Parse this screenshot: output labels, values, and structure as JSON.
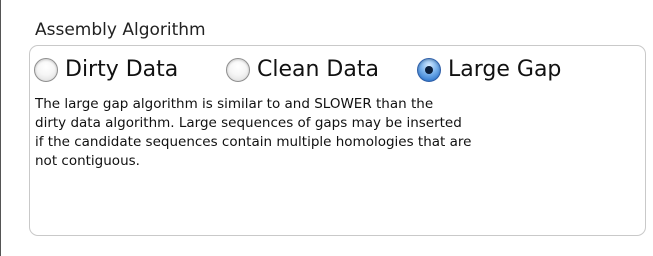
{
  "group": {
    "title": "Assembly Algorithm"
  },
  "radios": [
    {
      "label": "Dirty Data",
      "checked": false
    },
    {
      "label": "Clean Data",
      "checked": false
    },
    {
      "label": "Large Gap",
      "checked": true
    }
  ],
  "description": {
    "lines": [
      "The large gap algorithm is similar to and SLOWER than the",
      "dirty data algorithm. Large sequences of gaps may be inserted",
      "if the candidate sequences contain multiple homologies that are",
      "not contiguous."
    ]
  },
  "colors": {
    "selected_radio": "#2f78d0",
    "group_border": "#c9c9c9"
  }
}
